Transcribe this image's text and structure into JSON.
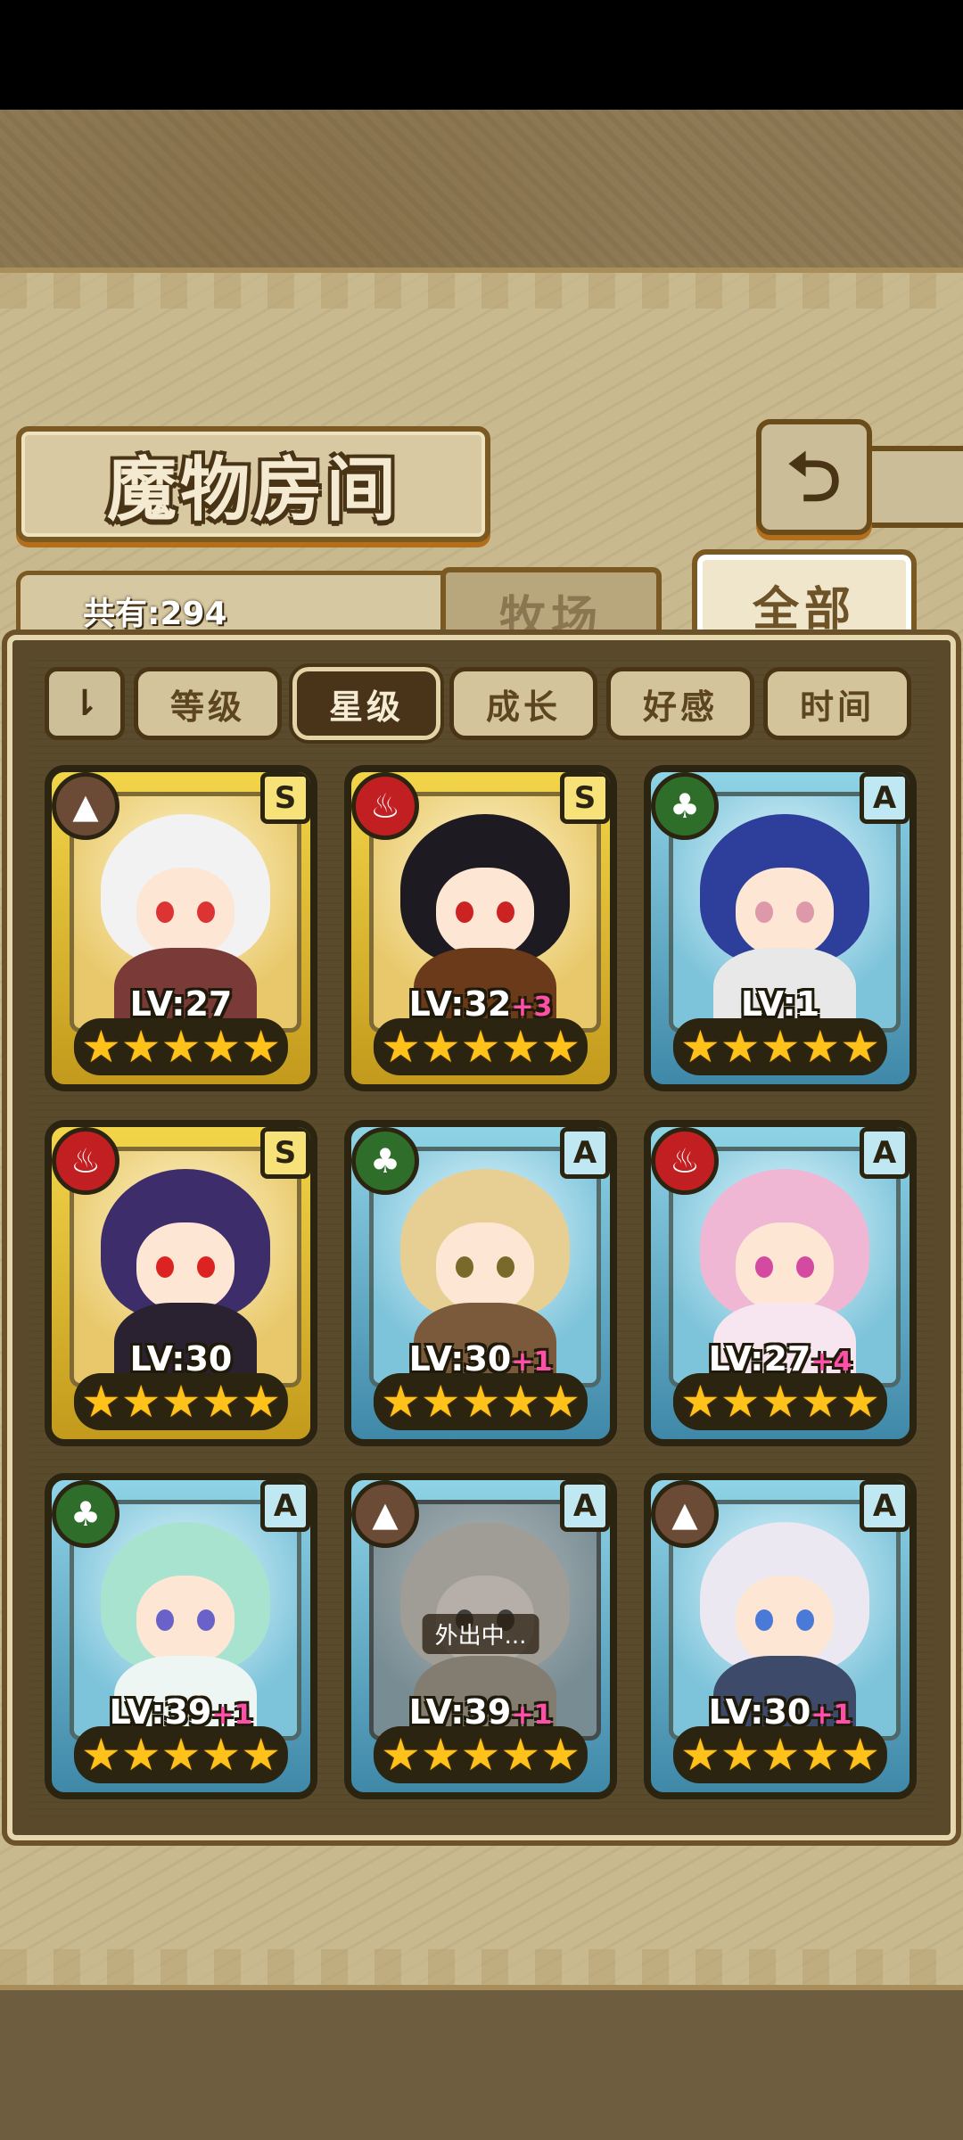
{
  "title": "魔物房间",
  "back_icon_glyph": "⮌",
  "total_count": "共有:294",
  "tabs": {
    "ranch": "牧场",
    "all": "全部"
  },
  "sort": {
    "toggle_glyph": "⇂",
    "level": "等级",
    "star": "星级",
    "growth": "成长",
    "affection": "好感",
    "time": "时间",
    "active": "星级"
  },
  "element_glyphs": {
    "earth": "▲",
    "fire": "♨",
    "wood": "♣"
  },
  "colors": {
    "earth": "#6b4a36",
    "fire": "#c21f22",
    "wood": "#2f6e2a",
    "accent_pink": "#ff4fa8",
    "star": "#ffc21a"
  },
  "monsters": [
    {
      "element": "earth",
      "rank": "S",
      "level": "LV:27",
      "bonus": "",
      "stars": "★★★★★",
      "status": ""
    },
    {
      "element": "fire",
      "rank": "S",
      "level": "LV:32",
      "bonus": "+3",
      "stars": "★★★★★",
      "status": ""
    },
    {
      "element": "wood",
      "rank": "A",
      "level": "LV:1",
      "bonus": "",
      "stars": "★★★★★",
      "status": ""
    },
    {
      "element": "fire",
      "rank": "S",
      "level": "LV:30",
      "bonus": "",
      "stars": "★★★★★",
      "status": ""
    },
    {
      "element": "wood",
      "rank": "A",
      "level": "LV:30",
      "bonus": "+1",
      "stars": "★★★★★",
      "status": ""
    },
    {
      "element": "fire",
      "rank": "A",
      "level": "LV:27",
      "bonus": "+4",
      "stars": "★★★★★",
      "status": ""
    },
    {
      "element": "wood",
      "rank": "A",
      "level": "LV:39",
      "bonus": "+1",
      "stars": "★★★★★",
      "status": ""
    },
    {
      "element": "earth",
      "rank": "A",
      "level": "LV:39",
      "bonus": "+1",
      "stars": "★★★★★",
      "status": "外出中..."
    },
    {
      "element": "earth",
      "rank": "A",
      "level": "LV:30",
      "bonus": "+1",
      "stars": "★★★★★",
      "status": ""
    }
  ]
}
